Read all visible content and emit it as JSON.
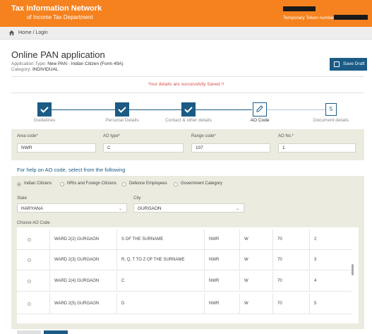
{
  "header": {
    "brand_line1": "Tax Information Network",
    "brand_line2": "of Income Tax Department",
    "token_label": "Temporary Token number:",
    "accent": "#f5821f"
  },
  "breadcrumb": {
    "text": "Home / Login",
    "icon": "home-icon"
  },
  "page": {
    "title": "Online PAN application",
    "app_type_label": "Application Type: ",
    "app_type_value": "New PAN - Indian Citizen (Form 49A)",
    "category_label": "Category: ",
    "category_value": "INDIVIDUAL",
    "save_button": "Save Draft",
    "saved_message": "Your details are successfully Saved !!"
  },
  "steps": [
    {
      "label": "Guidelines",
      "state": "done"
    },
    {
      "label": "Personal Details",
      "state": "done"
    },
    {
      "label": "Contact & other details",
      "state": "done"
    },
    {
      "label": "AO Code",
      "state": "active"
    },
    {
      "label": "Document details",
      "state": "pending",
      "number": "5"
    }
  ],
  "ao_form": {
    "area_code_label": "Area code*",
    "area_code_value": "NWR",
    "ao_type_label": "AO type*",
    "ao_type_value": "C",
    "range_code_label": "Range code*",
    "range_code_value": "107",
    "ao_no_label": "AO No.*",
    "ao_no_value": "1"
  },
  "help_text": "For help on AO code, select from the following",
  "filters": {
    "options": [
      "Indian Citizens",
      "NRIs and Foreign Citizens",
      "Defence Employees",
      "Government Category"
    ],
    "selected": "Indian Citizens",
    "state_label": "State",
    "state_value": "HARYANA",
    "city_label": "City",
    "city_value": "GURGAON",
    "choose_label": "Choose AO Code"
  },
  "ao_table": {
    "rows": [
      [
        "WARD 2(2) GURGAON",
        "S OF THE SURNAME",
        "NWR",
        "W",
        "70",
        "2"
      ],
      [
        "WARD 2(3) GURGAON",
        "R, Q, T TO Z OF THE SURNAME",
        "NWR",
        "W",
        "70",
        "3"
      ],
      [
        "WARD 2(4) GURGAON",
        "C",
        "NWR",
        "W",
        "70",
        "4"
      ],
      [
        "WARD 2(5) GURGAON",
        "D",
        "NWR",
        "W",
        "70",
        "5"
      ]
    ]
  },
  "colors": {
    "primary": "#1b5b85",
    "panel": "#ebebdf",
    "alert": "#d9534f"
  }
}
